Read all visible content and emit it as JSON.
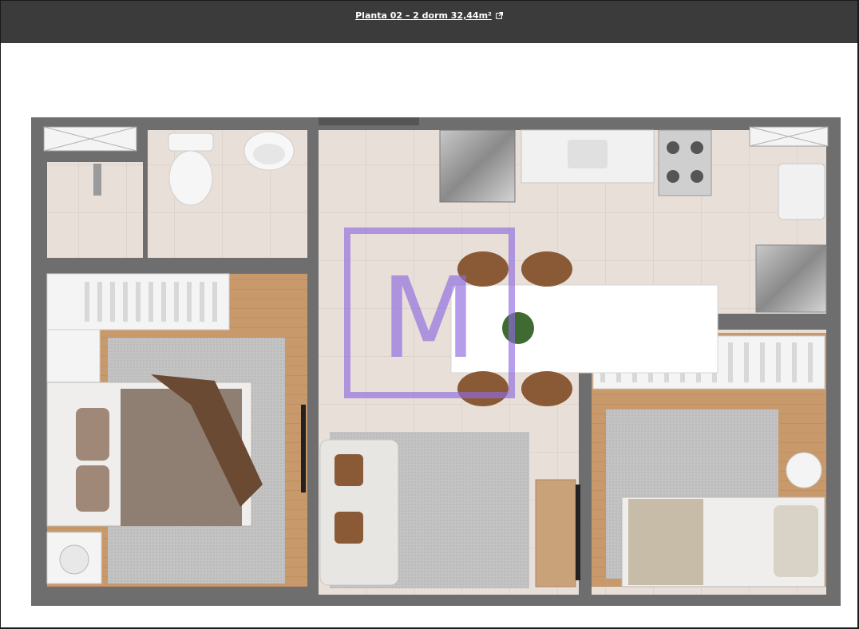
{
  "header": {
    "title": "Planta 02 – 2 dorm 32,44m²",
    "external_icon": "external-link-icon"
  },
  "floorplan": {
    "watermark_letter": "M",
    "colors": {
      "wall": "#6e6e6e",
      "tile_floor": "#e6ddd6",
      "wood_floor": "#c4966a",
      "rug": "#bdbdbd",
      "watermark": "#8f6ae0",
      "chair": "#8a5a36",
      "bedding": "#8f7f73"
    }
  }
}
